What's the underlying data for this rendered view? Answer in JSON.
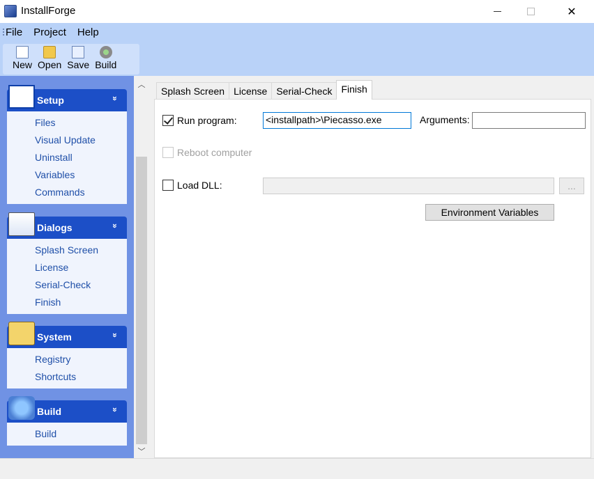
{
  "window": {
    "title": "InstallForge"
  },
  "menu": [
    "File",
    "Project",
    "Help"
  ],
  "toolbar": [
    {
      "label": "New",
      "icon": "new-file-icon"
    },
    {
      "label": "Open",
      "icon": "open-folder-icon"
    },
    {
      "label": "Save",
      "icon": "save-icon"
    },
    {
      "label": "Build",
      "icon": "build-gear-icon"
    }
  ],
  "sidebar": {
    "groups": [
      {
        "title": "Setup",
        "icon": "setup-window-icon",
        "items": [
          "Files",
          "Visual Update",
          "Uninstall",
          "Variables",
          "Commands"
        ]
      },
      {
        "title": "Dialogs",
        "icon": "presentation-board-icon",
        "items": [
          "Splash Screen",
          "License",
          "Serial-Check",
          "Finish"
        ]
      },
      {
        "title": "System",
        "icon": "system-gear-icon",
        "items": [
          "Registry",
          "Shortcuts"
        ]
      },
      {
        "title": "Build",
        "icon": "build-disc-icon",
        "items": [
          "Build"
        ]
      }
    ],
    "collapse_glyph": "»"
  },
  "tabs": [
    {
      "label": "Splash Screen",
      "active": false
    },
    {
      "label": "License",
      "active": false
    },
    {
      "label": "Serial-Check",
      "active": false
    },
    {
      "label": "Finish",
      "active": true
    }
  ],
  "finish": {
    "run_program": {
      "label": "Run program:",
      "checked": true,
      "value": "<installpath>\\Piecasso.exe"
    },
    "arguments": {
      "label": "Arguments:",
      "value": ""
    },
    "reboot": {
      "label": "Reboot computer",
      "checked": false,
      "disabled": true
    },
    "load_dll": {
      "label": "Load DLL:",
      "checked": false,
      "value": ""
    },
    "browse_label": "...",
    "env_button": "Environment Variables"
  }
}
